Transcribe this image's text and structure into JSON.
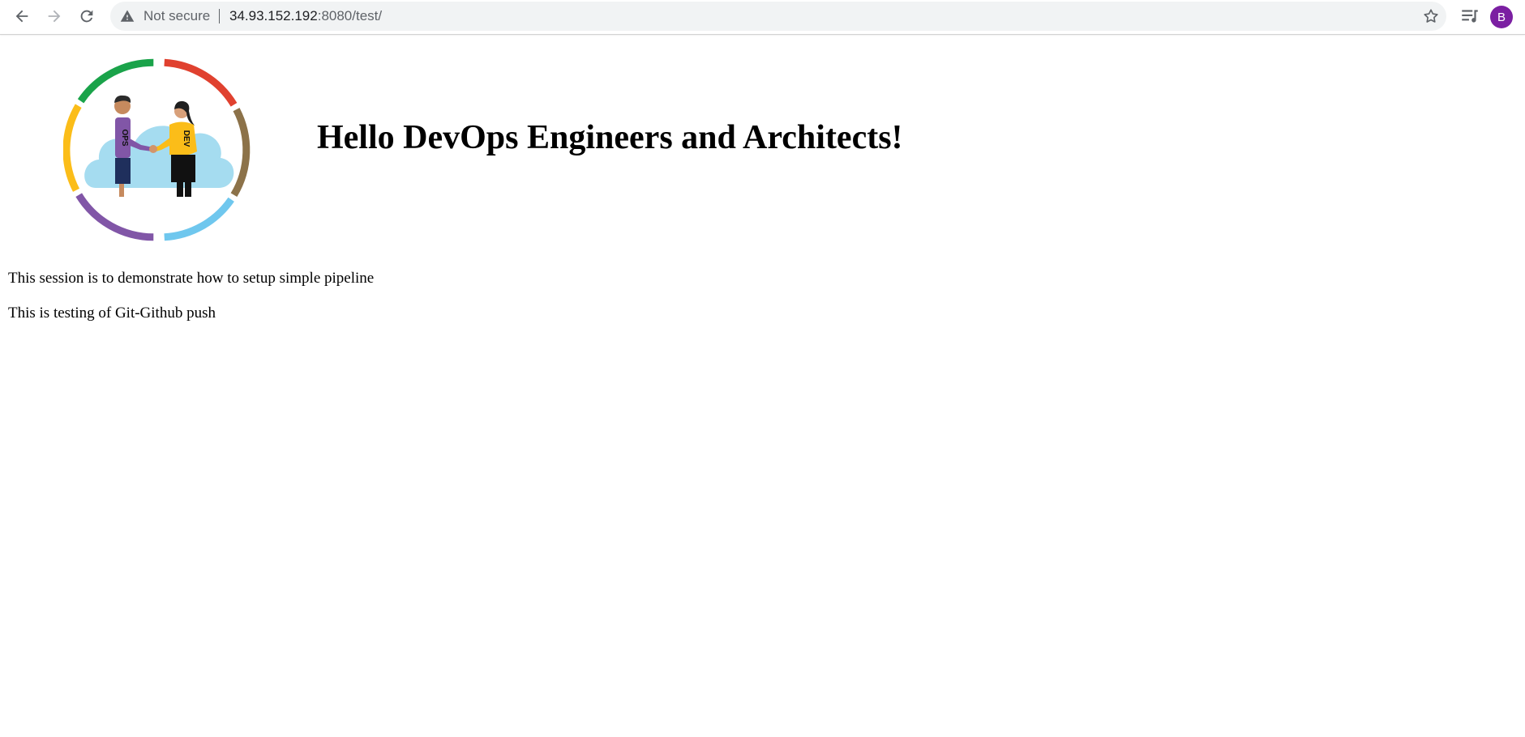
{
  "browser": {
    "security_label": "Not secure",
    "url_host": "34.93.152.192",
    "url_rest": ":8080/test/",
    "profile_initial": "B",
    "profile_color": "#7b1fa2"
  },
  "page": {
    "logo_badges": {
      "left": "OPS",
      "right": "DEV"
    },
    "heading": "Hello DevOps Engineers and Architects!",
    "paragraphs": [
      "This session is to demonstrate how to setup simple pipeline",
      "This is testing of Git-Github push"
    ]
  },
  "colors": {
    "ring_green": "#1aa34a",
    "ring_red": "#e0412f",
    "ring_brown": "#8c7249",
    "ring_light_blue": "#6fc7ee",
    "ring_purple": "#8156a7",
    "ring_yellow": "#fbbd19",
    "cloud": "#a5dcf0"
  }
}
